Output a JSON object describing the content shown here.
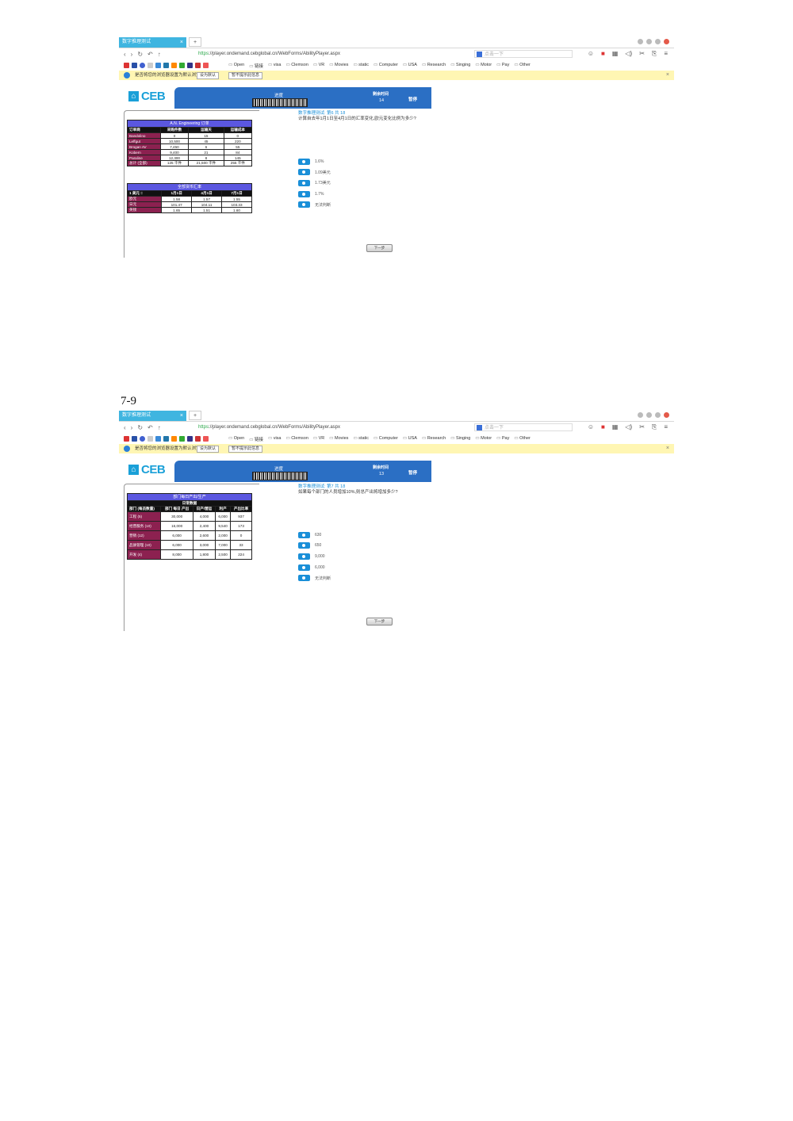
{
  "page_label": "7-9",
  "browser": {
    "tab_title": "数字推理测试",
    "tab_close": "×",
    "new_tab": "+",
    "nav_buttons": [
      "‹",
      "›",
      "↻",
      "↶",
      "↑"
    ],
    "url_secure_part": "https",
    "url_rest": "://player.ondemand.cebglobal.cn/WebForms/AbilityPlayer.aspx",
    "search_placeholder": "点击一下",
    "bookmarks": [
      "Open",
      "链接",
      "visa",
      "Clemson",
      "VR",
      "Movies",
      "static",
      "Computer",
      "USA",
      "Research",
      "Singing",
      "Motor",
      "Pay",
      "Other"
    ],
    "infobar_message": "是否将您的浏览器设置为默认浏览器?",
    "infobar_btn1": "设为默认",
    "infobar_btn2": "暂不提示此信息",
    "infobar_close": "×",
    "tool_icons": [
      "☺",
      "■",
      "▦",
      "◁)",
      "✂",
      "⎘",
      "≡"
    ]
  },
  "colors": {
    "accent": "#1a8fd8",
    "header": "#2b6fc4",
    "table_caption": "#5b57e0",
    "row_label": "#8c2150",
    "infobar": "#fff6b3"
  },
  "screens": [
    {
      "logo": "CEB",
      "progress_label": "进度",
      "time_label": "剩余时间",
      "time_value": "14",
      "pause": "暂停",
      "question_number": "数字推理测试: 第6 共 18",
      "question_text": "计算自去年1月1日至4月1日的汇率变化,欧元变化比例为多少?",
      "options": [
        "1.6%",
        "1.09美元",
        "1.73美元",
        "1.7%",
        "无法判断"
      ],
      "next": "下一步",
      "table1": {
        "caption": "A.N. Engineering 订单",
        "headers": [
          "订单商",
          "采购件数",
          "运输天",
          "运输成本"
        ],
        "rows": [
          [
            "Bandolino",
            "0",
            "15",
            "0"
          ],
          [
            "Leffgut",
            "10,500",
            "45",
            "220"
          ],
          [
            "Brogan AV",
            "7,450",
            "6",
            "55"
          ],
          [
            "Kobern",
            "9,400",
            "21",
            "84"
          ],
          [
            "Paraline",
            "12,300",
            "8",
            "145"
          ],
          [
            "总计 (全部)",
            "125 千件",
            "21,500 千件",
            "255 千件"
          ]
        ]
      },
      "table2": {
        "caption": "全部货币汇率",
        "headers": [
          "1 美元 =",
          "1月1日",
          "4月1日",
          "7月1日"
        ],
        "rows": [
          [
            "欧元",
            "1.58",
            "1.57",
            "1.55"
          ],
          [
            "日元",
            "101.47",
            "104.11",
            "103.33"
          ],
          [
            "英镑",
            "1.65",
            "1.51",
            "1.60"
          ]
        ]
      }
    },
    {
      "logo": "CEB",
      "progress_label": "进度",
      "time_label": "剩余时间",
      "time_value": "13",
      "pause": "暂停",
      "question_number": "数字推理测试: 第7 共 18",
      "question_text": "如果每个部门的人员增加10%,则总产出将增加多少?",
      "options": [
        "630",
        "650",
        "9,000",
        "6,000",
        "无法判断"
      ],
      "next": "下一步",
      "table1": {
        "caption": "部门每日产出/生产",
        "subcaption": "日常数据",
        "headers": [
          "部门 (每员数量)",
          "部门 每日 产出",
          "日产/营运",
          "利产",
          "产出比率"
        ],
        "rows": [
          [
            "工程 (5)",
            "30,000",
            "4,000",
            "6,000",
            "937"
          ],
          [
            "经营服务 (10)",
            "16,000",
            "2,400",
            "9,540",
            "173"
          ],
          [
            "营销 (12)",
            "6,000",
            "2,600",
            "2,000",
            "0"
          ],
          [
            "品质管理 (10)",
            "6,000",
            "3,000",
            "7,000",
            "33"
          ],
          [
            "开发 (4)",
            "8,000",
            "1,800",
            "2,500",
            "224"
          ]
        ]
      }
    }
  ]
}
